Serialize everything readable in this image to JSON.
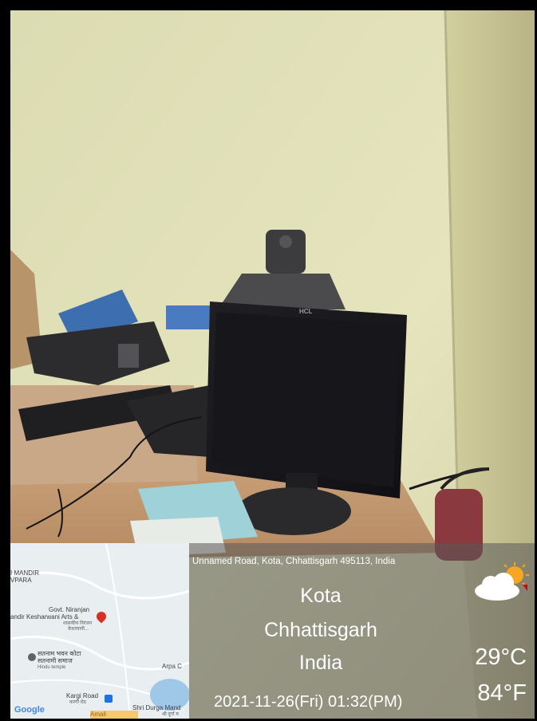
{
  "location": {
    "address": "Unnamed Road, Kota, Chhattisgarh 495113, India",
    "city": "Kota",
    "state": "Chhattisgarh",
    "country": "India"
  },
  "datetime": "2021-11-26(Fri)   01:32(PM)",
  "weather": {
    "icon": "partly-cloudy-sun-icon",
    "temp_c": "29°C",
    "temp_f": "84°F"
  },
  "map": {
    "labels": {
      "mandir": "I MANDIR",
      "vpara": "VPARA",
      "govt": "Govt. Niranjan",
      "kesharwani": "andir Kesharwani Arts &",
      "govt_hindi": "शासकीय निरंजन",
      "kesharwani_hindi": "केशरवानी...",
      "satnam": "सतनाम भवन कोटा",
      "satnami": "सतनामी समाज",
      "hindu_temple": "Hindu temple",
      "arpa": "Arpa C",
      "kargi": "Kargi Road",
      "kargi_hindi": "करगी रोड",
      "amali": "Amali",
      "durga": "Shri Durga Mand",
      "durga_hindi": "श्री दुर्गा म"
    },
    "attribution": "Google"
  },
  "brand_on_monitor": "HCL"
}
